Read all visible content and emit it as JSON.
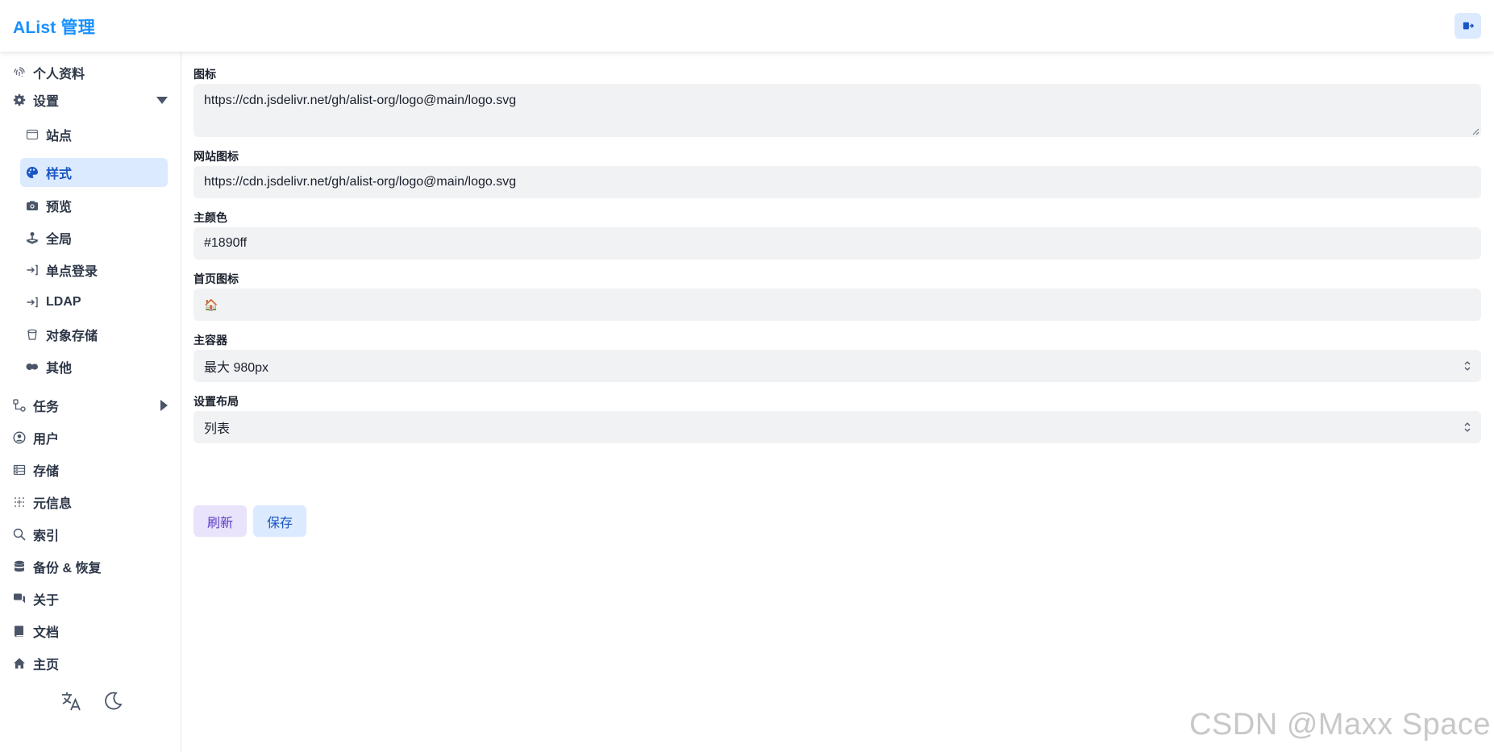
{
  "header": {
    "brand": "AList 管理",
    "logout_icon": "logout-icon"
  },
  "sidebar": {
    "items": [
      {
        "label": "个人资料",
        "icon": "fingerprint-icon"
      },
      {
        "label": "设置",
        "icon": "gear-icon",
        "expanded": true
      },
      {
        "label": "站点",
        "icon": "window-icon"
      },
      {
        "label": "样式",
        "icon": "palette-icon",
        "active": true
      },
      {
        "label": "预览",
        "icon": "camera-icon"
      },
      {
        "label": "全局",
        "icon": "joystick-icon"
      },
      {
        "label": "单点登录",
        "icon": "login-icon"
      },
      {
        "label": "LDAP",
        "icon": "login-icon"
      },
      {
        "label": "对象存储",
        "icon": "bucket-icon"
      },
      {
        "label": "其他",
        "icon": "toggle-icon"
      },
      {
        "label": "任务",
        "icon": "flow-icon",
        "expanded": false
      },
      {
        "label": "用户",
        "icon": "user-circle-icon"
      },
      {
        "label": "存储",
        "icon": "storage-icon"
      },
      {
        "label": "元信息",
        "icon": "grid-dots-icon"
      },
      {
        "label": "索引",
        "icon": "search-icon"
      },
      {
        "label": "备份 & 恢复",
        "icon": "database-icon"
      },
      {
        "label": "关于",
        "icon": "chat-icon"
      },
      {
        "label": "文档",
        "icon": "book-icon"
      },
      {
        "label": "主页",
        "icon": "home-icon"
      }
    ],
    "bottom": {
      "language_icon": "translate-icon",
      "theme_icon": "moon-icon"
    }
  },
  "form": {
    "logo": {
      "label": "图标",
      "value": "https://cdn.jsdelivr.net/gh/alist-org/logo@main/logo.svg"
    },
    "favicon": {
      "label": "网站图标",
      "value": "https://cdn.jsdelivr.net/gh/alist-org/logo@main/logo.svg"
    },
    "main_color": {
      "label": "主颜色",
      "value": "#1890ff"
    },
    "home_icon": {
      "label": "首页图标",
      "value": "🏠"
    },
    "main_container": {
      "label": "主容器",
      "value": "最大 980px"
    },
    "settings_layout": {
      "label": "设置布局",
      "value": "列表"
    },
    "buttons": {
      "refresh": "刷新",
      "save": "保存"
    }
  },
  "watermark": "CSDN @Maxx Space",
  "colors": {
    "accent": "#1890ff",
    "active_bg": "#dbeafe"
  }
}
